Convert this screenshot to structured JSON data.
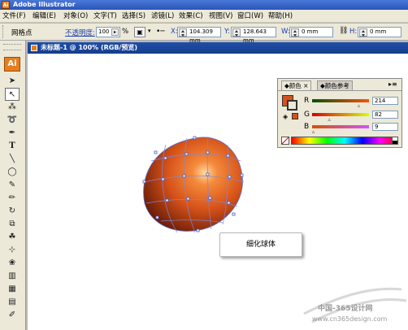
{
  "app": {
    "title": "Adobe Illustrator",
    "icon_text": "Ai"
  },
  "menu": [
    "文件(F)",
    "编辑(E)",
    "对象(O)",
    "文字(T)",
    "选择(S)",
    "滤镜(L)",
    "效果(C)",
    "视图(V)",
    "窗口(W)",
    "帮助(H)"
  ],
  "options": {
    "tool_name": "网格点",
    "opacity_label": "不透明度:",
    "opacity_value": "100",
    "percent": "%",
    "x_label": "X:",
    "x_value": "104.309 mm",
    "y_label": "Y:",
    "y_value": "128.643 mm",
    "w_label": "W:",
    "w_value": "0 mm",
    "h_label": "H:",
    "h_value": "0 mm"
  },
  "document": {
    "tab_title": "未标题-1 @ 100% (RGB/预览)"
  },
  "color_panel": {
    "tabs": [
      "颜色",
      "颜色参考"
    ],
    "close": "×",
    "fill_color": "#d6521a",
    "channels": [
      {
        "label": "R",
        "value": "214",
        "fraction": 0.84
      },
      {
        "label": "G",
        "value": "82",
        "fraction": 0.32
      },
      {
        "label": "B",
        "value": "9",
        "fraction": 0.04
      }
    ]
  },
  "tooltip": {
    "text": "细化球体"
  },
  "watermark": {
    "site_cn": "中国-365设计网",
    "url": "www.cn365design.com"
  }
}
